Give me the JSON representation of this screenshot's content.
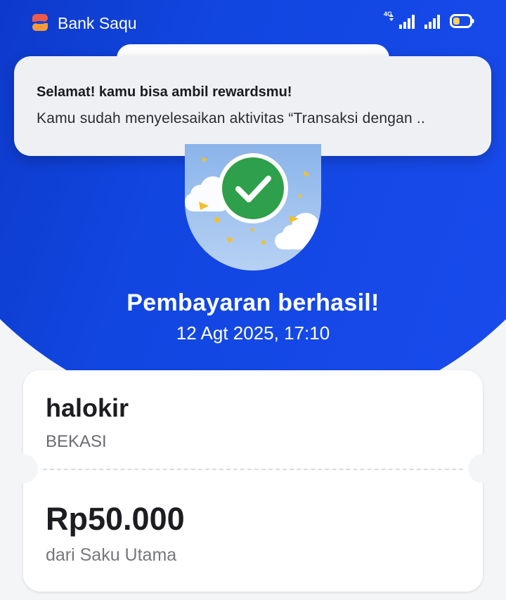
{
  "status_bar": {
    "app_name": "Bank Saqu",
    "network_label": "4G",
    "icons": [
      "app-logo-icon",
      "signal-4g-icon",
      "signal-icon",
      "battery-icon"
    ],
    "battery_level": 0.4
  },
  "notification": {
    "title": "Selamat! kamu bisa ambil rewardsmu!",
    "body": "Kamu sudah menyelesaikan aktivitas “Transaksi dengan .."
  },
  "result": {
    "icon": "checkmark-icon",
    "title": "Pembayaran berhasil!",
    "datetime": "12 Agt 2025, 17:10"
  },
  "receipt": {
    "merchant_name": "halokir",
    "merchant_city": "BEKASI",
    "amount": "Rp50.000",
    "source": "dari Saku Utama"
  },
  "colors": {
    "hero_blue": "#1146e0",
    "success_green": "#2e9f4a",
    "confetti_yellow": "#f2c02c"
  }
}
